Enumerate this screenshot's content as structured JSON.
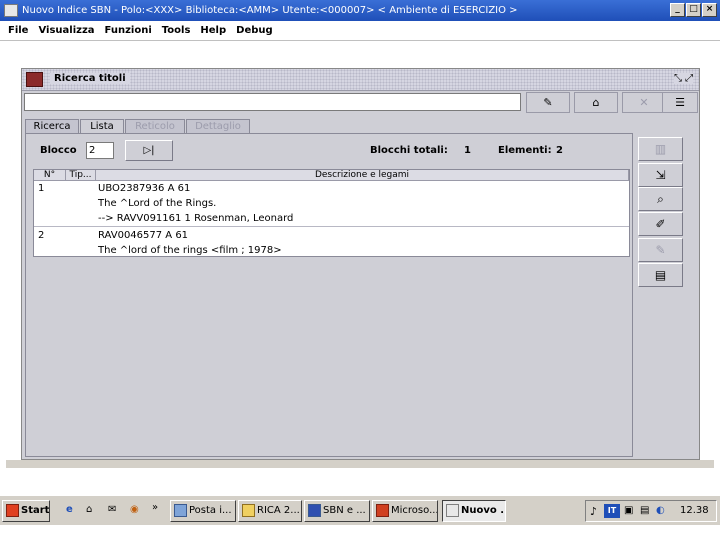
{
  "window": {
    "title": "Nuovo Indice SBN - Polo:<XXX> Biblioteca:<AMM> Utente:<000007>      < Ambiente di ESERCIZIO >",
    "minimize_glyph": "_",
    "maximize_glyph": "□",
    "close_glyph": "×"
  },
  "menu": [
    "File",
    "Visualizza",
    "Funzioni",
    "Tools",
    "Help",
    "Debug"
  ],
  "frame": {
    "title": "Ricerca titoli",
    "ctrl_glyph": "⤡ ⤢"
  },
  "toolbar": {
    "input_value": "",
    "buttons": [
      "✎",
      "⌂",
      "✕",
      "☰"
    ]
  },
  "tabs": [
    {
      "label": "Ricerca",
      "state": "normal"
    },
    {
      "label": "Lista",
      "state": "active"
    },
    {
      "label": "Reticolo",
      "state": "disabled"
    },
    {
      "label": "Dettaglio",
      "state": "disabled"
    }
  ],
  "paging": {
    "blocco_label": "Blocco",
    "blocco_value": "2",
    "next_glyph": "▷|",
    "blocchi_label": "Blocchi totali:",
    "blocchi_value": "1",
    "elementi_label": "Elementi:",
    "elementi_value": "2"
  },
  "table": {
    "headers": [
      "N°",
      "Tip...",
      "Descrizione e legami"
    ],
    "rows": [
      {
        "n": "1",
        "tip": "",
        "lines": [
          "UBO2387936 A 61",
          "The ^Lord of the Rings.",
          "--> RAVV091161 1  Rosenman, Leonard"
        ]
      },
      {
        "n": "2",
        "tip": "",
        "lines": [
          "RAV0046577 A 61",
          "The ^lord of the rings <film ; 1978>"
        ]
      }
    ]
  },
  "side_buttons": [
    {
      "glyph": "▥",
      "enabled": false
    },
    {
      "glyph": "⇲",
      "enabled": true
    },
    {
      "glyph": "⌕",
      "enabled": true
    },
    {
      "glyph": "✐",
      "enabled": true
    },
    {
      "glyph": "✎",
      "enabled": false
    },
    {
      "glyph": "▤",
      "enabled": true
    }
  ],
  "taskbar": {
    "start": "Start",
    "quick": [
      "e",
      "⌂",
      "✉",
      "◉",
      "»"
    ],
    "tasks": [
      {
        "label": "Posta i...",
        "active": false
      },
      {
        "label": "RICA 2...",
        "active": false
      },
      {
        "label": "SBN e ...",
        "active": false
      },
      {
        "label": "Microso...",
        "active": false
      },
      {
        "label": "Nuovo ...",
        "active": true
      }
    ],
    "tray_lang": "IT",
    "clock": "12.38"
  },
  "colors": {
    "titlebar": "#1f4fb8",
    "frame_bg": "#cfcfd6",
    "tab_disabled": "#9c9cac"
  }
}
